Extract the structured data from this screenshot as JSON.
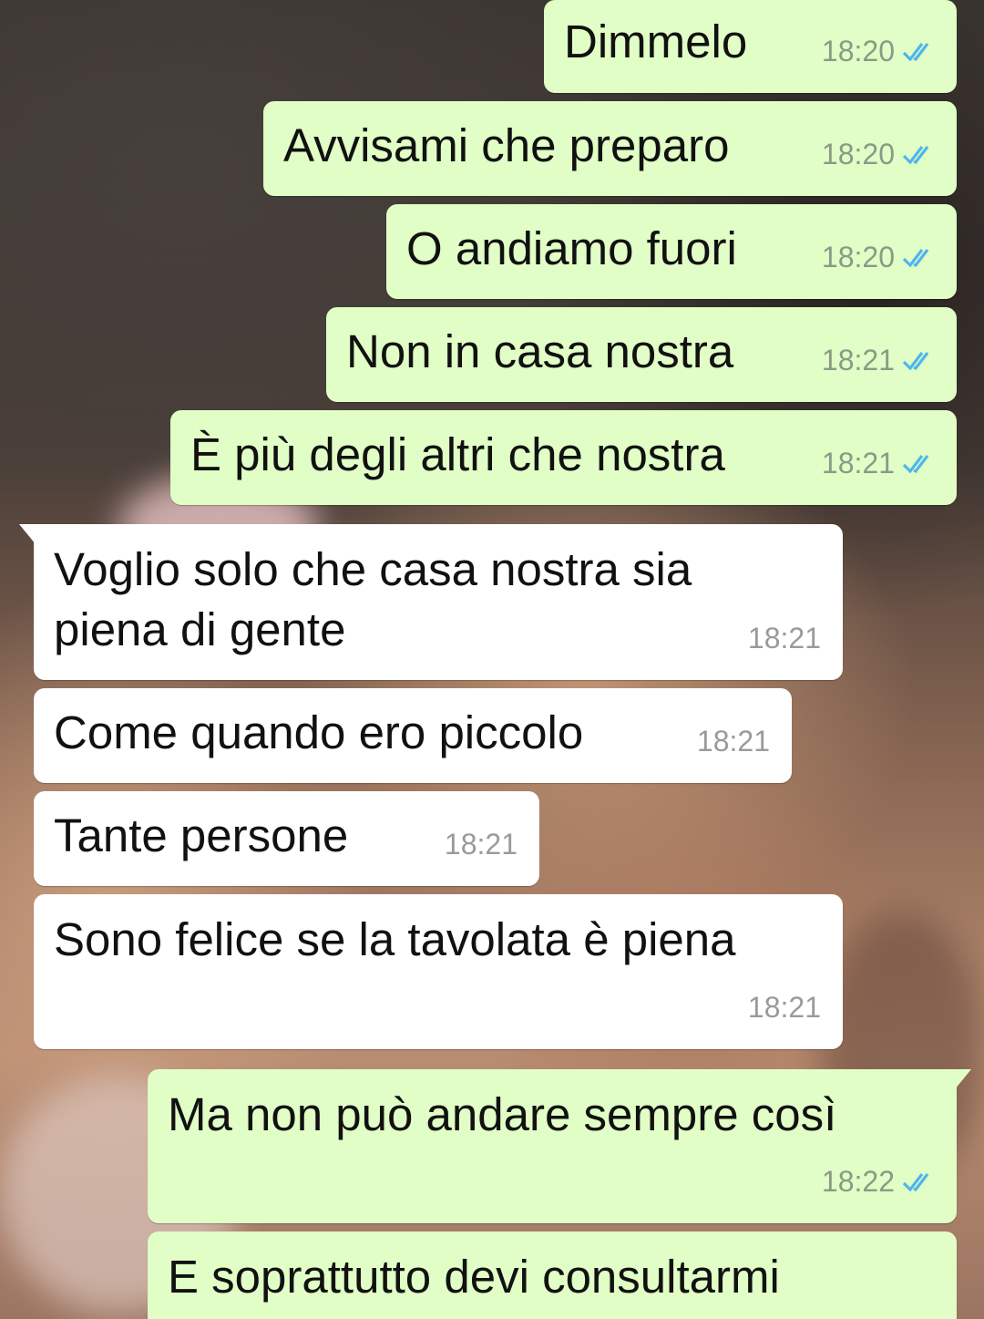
{
  "conversation": {
    "messages": [
      {
        "id": "m1",
        "direction": "outgoing",
        "text": "Dimmelo",
        "time": "18:20",
        "status": "read"
      },
      {
        "id": "m2",
        "direction": "outgoing",
        "text": "Avvisami che preparo",
        "time": "18:20",
        "status": "read"
      },
      {
        "id": "m3",
        "direction": "outgoing",
        "text": "O andiamo fuori",
        "time": "18:20",
        "status": "read"
      },
      {
        "id": "m4",
        "direction": "outgoing",
        "text": "Non in casa nostra",
        "time": "18:21",
        "status": "read"
      },
      {
        "id": "m5",
        "direction": "outgoing",
        "text": "È più degli altri che nostra",
        "time": "18:21",
        "status": "read"
      },
      {
        "id": "m6",
        "direction": "incoming",
        "line1": "Voglio solo che casa nostra sia",
        "line2": "piena di gente",
        "time": "18:21"
      },
      {
        "id": "m7",
        "direction": "incoming",
        "text": "Come quando ero piccolo",
        "time": "18:21"
      },
      {
        "id": "m8",
        "direction": "incoming",
        "text": "Tante persone",
        "time": "18:21"
      },
      {
        "id": "m9",
        "direction": "incoming",
        "text": "Sono felice se la tavolata è piena",
        "time": "18:21"
      },
      {
        "id": "m10",
        "direction": "outgoing",
        "text": "Ma non può andare sempre così",
        "time": "18:22",
        "status": "read"
      },
      {
        "id": "m11",
        "direction": "outgoing",
        "text": "E soprattutto devi consultarmi"
      }
    ]
  },
  "colors": {
    "outgoing_bubble": "#e1fec6",
    "incoming_bubble": "#ffffff",
    "read_ticks": "#4fb6ec",
    "timestamp": "#8a9a86"
  },
  "icons": {
    "read_receipt": "double-check-icon"
  }
}
